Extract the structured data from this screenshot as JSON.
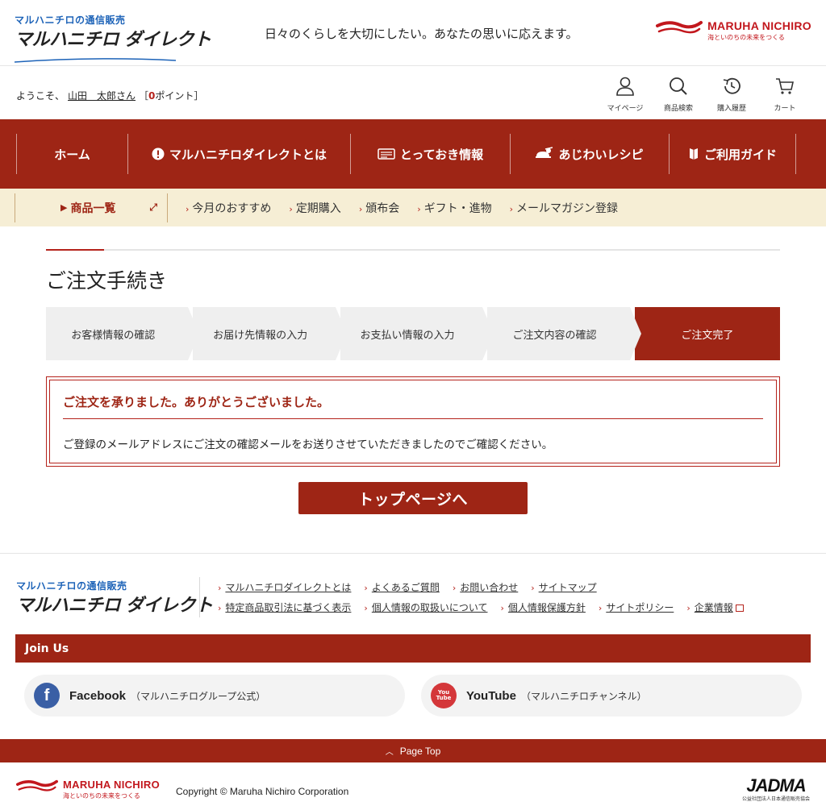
{
  "header": {
    "logo_sub": "マルハニチロの通信販売",
    "logo_main": "マルハニチロ ダイレクト",
    "tagline": "日々のくらしを大切にしたい。あなたの思いに応えます。",
    "corp_name": "MARUHA NICHIRO",
    "corp_sub": "海といのちの未来をつくる",
    "brand_color": "#c2171d"
  },
  "userbar": {
    "welcome_prefix": "ようこそ、",
    "user_name": "山田　太郎さん",
    "points_open": "［",
    "points_value": "0",
    "points_suffix": "ポイント］",
    "icons": [
      {
        "label": "マイページ",
        "icon": "person-icon"
      },
      {
        "label": "商品検索",
        "icon": "search-icon"
      },
      {
        "label": "購入履歴",
        "icon": "history-icon"
      },
      {
        "label": "カート",
        "icon": "cart-icon"
      }
    ]
  },
  "mainnav": {
    "items": [
      {
        "label": "ホーム",
        "icon": ""
      },
      {
        "label": "マルハニチロダイレクトとは",
        "icon": "info-icon"
      },
      {
        "label": "とっておき情報",
        "icon": "newspaper-icon"
      },
      {
        "label": "あじわいレシピ",
        "icon": "cooking-icon"
      },
      {
        "label": "ご利用ガイド",
        "icon": "book-icon"
      }
    ],
    "accent": "#9e2515"
  },
  "subnav": {
    "products_label": "商品一覧",
    "items": [
      "今月のおすすめ",
      "定期購入",
      "頒布会",
      "ギフト・進物",
      "メールマガジン登録"
    ],
    "background": "#f6eed5"
  },
  "main": {
    "page_title": "ご注文手続き",
    "steps": [
      "お客様情報の確認",
      "お届け先情報の入力",
      "お支払い情報の入力",
      "ご注文内容の確認",
      "ご注文完了"
    ],
    "active_step": 4,
    "message_title": "ご注文を承りました。ありがとうございました。",
    "message_body": "ご登録のメールアドレスにご注文の確認メールをお送りさせていただきましたのでご確認ください。",
    "top_button": "トップページへ"
  },
  "footer": {
    "links_row1": [
      "マルハニチロダイレクトとは",
      "よくあるご質問",
      "お問い合わせ",
      "サイトマップ"
    ],
    "links_row2": [
      "特定商品取引法に基づく表示",
      "個人情報の取扱いについて",
      "個人情報保護方針",
      "サイトポリシー",
      "企業情報"
    ],
    "join_us": "Join Us",
    "facebook_name": "Facebook",
    "facebook_desc": "（マルハニチログループ公式）",
    "youtube_name": "YouTube",
    "youtube_desc": "（マルハニチロチャンネル）",
    "youtube_icon_text_1": "You",
    "youtube_icon_text_2": "Tube",
    "page_top": "Page Top",
    "copyright": "Copyright © Maruha Nichiro Corporation",
    "jadma_mark": "JADMA",
    "jadma_sub": "公益社団法人日本通信販売協会"
  }
}
